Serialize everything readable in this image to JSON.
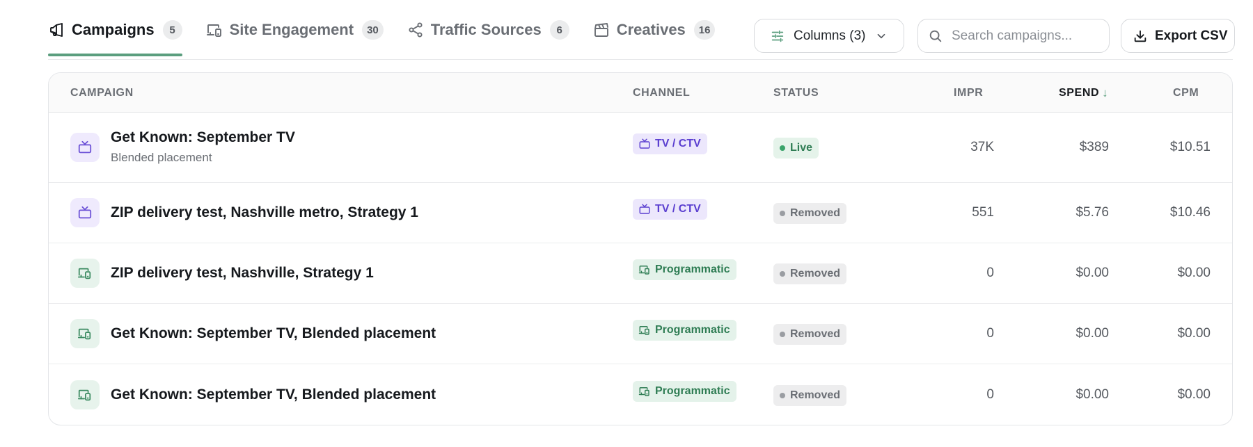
{
  "tabs": [
    {
      "label": "Campaigns",
      "count": "5",
      "icon": "megaphone-icon",
      "active": true
    },
    {
      "label": "Site Engagement",
      "count": "30",
      "icon": "devices-icon",
      "active": false
    },
    {
      "label": "Traffic Sources",
      "count": "6",
      "icon": "share-icon",
      "active": false
    },
    {
      "label": "Creatives",
      "count": "16",
      "icon": "clapperboard-icon",
      "active": false
    }
  ],
  "toolbar": {
    "columns_label": "Columns (3)",
    "search_placeholder": "Search campaigns...",
    "search_value": "",
    "export_label": "Export CSV"
  },
  "table": {
    "headers": {
      "campaign": "CAMPAIGN",
      "channel": "CHANNEL",
      "status": "STATUS",
      "impr": "IMPR",
      "spend": "SPEND",
      "spend_sort": "↓",
      "cpm": "CPM"
    },
    "rows": [
      {
        "name": "Get Known: September TV",
        "subtitle": "Blended placement",
        "channel": "TV / CTV",
        "channel_type": "tv",
        "status": "Live",
        "status_type": "live",
        "impr": "37K",
        "spend": "$389",
        "cpm": "$10.51"
      },
      {
        "name": "ZIP delivery test, Nashville metro, Strategy 1",
        "subtitle": "",
        "channel": "TV / CTV",
        "channel_type": "tv",
        "status": "Removed",
        "status_type": "removed",
        "impr": "551",
        "spend": "$5.76",
        "cpm": "$10.46"
      },
      {
        "name": "ZIP delivery test, Nashville, Strategy 1",
        "subtitle": "",
        "channel": "Programmatic",
        "channel_type": "prog",
        "status": "Removed",
        "status_type": "removed",
        "impr": "0",
        "spend": "$0.00",
        "cpm": "$0.00"
      },
      {
        "name": "Get Known: September TV, Blended placement",
        "subtitle": "",
        "channel": "Programmatic",
        "channel_type": "prog",
        "status": "Removed",
        "status_type": "removed",
        "impr": "0",
        "spend": "$0.00",
        "cpm": "$0.00"
      },
      {
        "name": "Get Known: September TV, Blended placement",
        "subtitle": "",
        "channel": "Programmatic",
        "channel_type": "prog",
        "status": "Removed",
        "status_type": "removed",
        "impr": "0",
        "spend": "$0.00",
        "cpm": "$0.00"
      }
    ]
  },
  "colors": {
    "accent": "#5b9e7e",
    "tv_chip_bg": "#ece7fc",
    "tv_chip_text": "#5b3fd0",
    "programmatic_chip_bg": "#e4f2ea",
    "programmatic_chip_text": "#2f7d54",
    "live_dot": "#3aa36a",
    "removed_dot": "#9a9da2"
  }
}
